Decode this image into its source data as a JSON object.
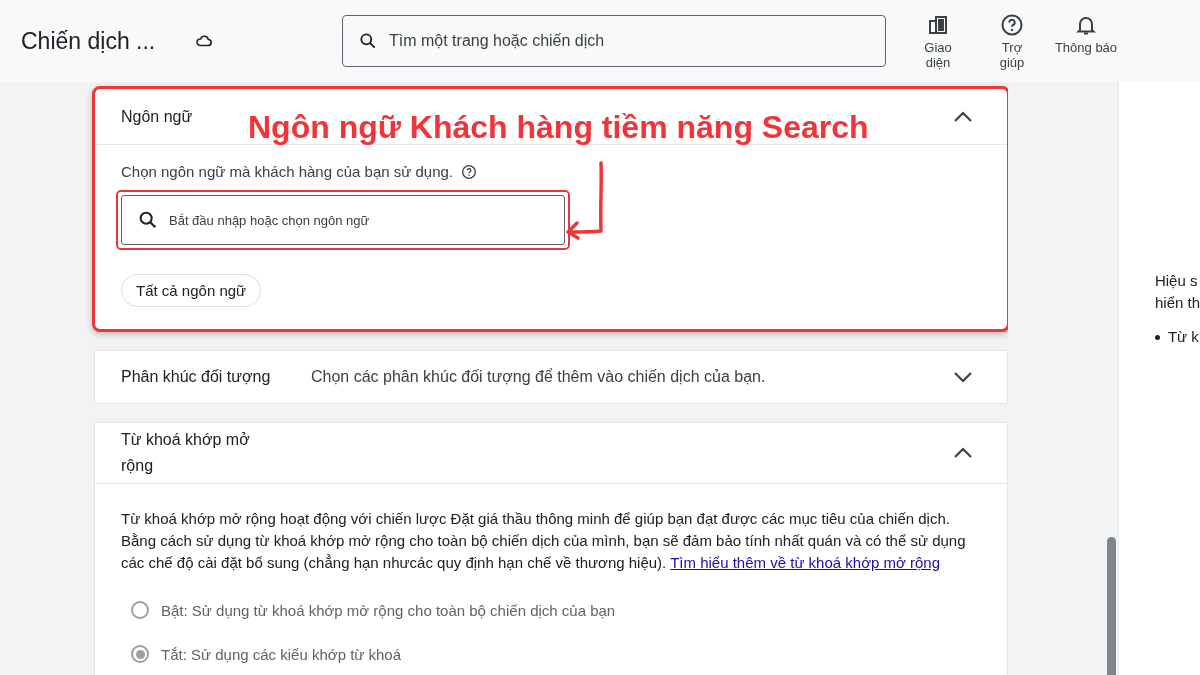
{
  "header": {
    "title": "Chiến dịch ...",
    "search": {
      "placeholder": "Tìm một trang hoặc chiến dịch"
    },
    "actions": [
      {
        "label": "Giao diện",
        "kind": "appearance"
      },
      {
        "label": "Trợ giúp",
        "kind": "help"
      },
      {
        "label": "Thông báo",
        "kind": "bell"
      }
    ]
  },
  "sections": [
    {
      "kind": "languages",
      "title": "Ngôn ngữ",
      "expanded": true,
      "highlighted": true,
      "description": "Chọn ngôn ngữ mà khách hàng của bạn sử dụng.",
      "field": {
        "placeholder": "Bắt đầu nhập hoặc chọn ngôn ngữ",
        "highlighted": true
      },
      "chips": [
        "Tất cả ngôn ngữ"
      ]
    },
    {
      "kind": "audience",
      "title": "Phân khúc đối tượng",
      "expanded": false,
      "highlighted": false,
      "summary": "Chọn các phân khúc đối tượng để thêm vào chiến dịch của bạn."
    },
    {
      "kind": "broad_match",
      "title": "Từ khoá khớp mở rộng",
      "expanded": true,
      "highlighted": false,
      "text": "Từ khoá khớp mở rộng hoạt động với chiến lược Đặt giá thầu thông minh để giúp bạn đạt được các mục tiêu của chiến dịch. Bằng cách sử dụng từ khoá khớp mở rộng cho toàn bộ chiến dịch của mình, bạn sẽ đảm bảo tính nhất quán và có thể sử dụng các chế độ cài đặt bổ sung (chẳng hạn nhưcác quy định hạn chế về thương hiệu).",
      "link": "Tìm hiểu thêm về từ khoá khớp mở rộng",
      "options": [
        {
          "label": "Bật: Sử dụng từ khoá khớp mở rộng cho toàn bộ chiến dịch của bạn",
          "selected": false
        },
        {
          "label": "Tắt: Sử dụng các kiểu khớp từ khoá",
          "selected": true
        }
      ]
    }
  ],
  "annotation": {
    "text": "Ngôn ngữ Khách hàng tiềm năng Search"
  },
  "side_panel": {
    "lines": [
      "Hiệu s",
      "hiển th"
    ],
    "bullets": [
      "Từ k"
    ]
  }
}
